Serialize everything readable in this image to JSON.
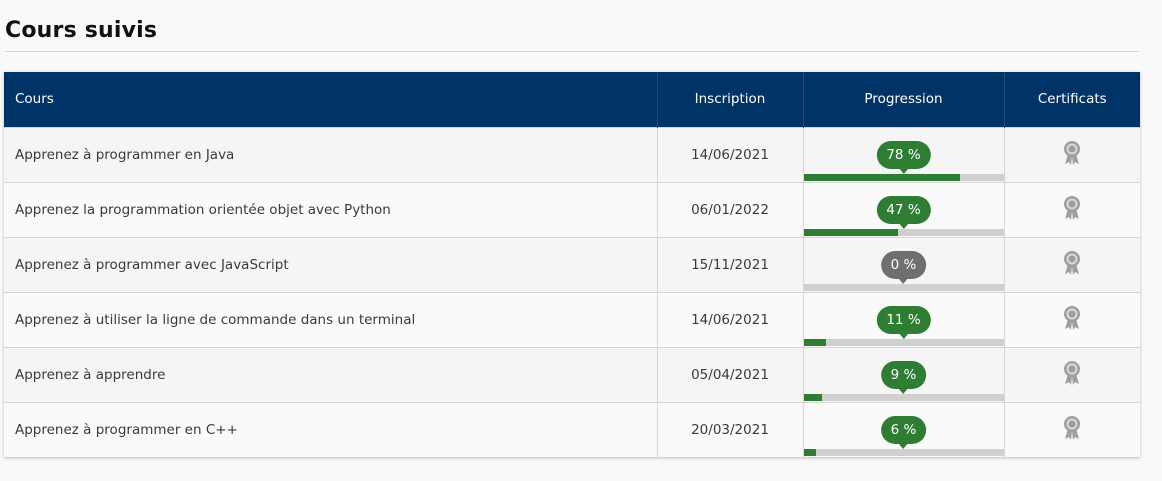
{
  "page": {
    "title": "Cours suivis"
  },
  "table": {
    "headers": {
      "course": "Cours",
      "enrollment": "Inscription",
      "progress": "Progression",
      "certificates": "Certificats"
    },
    "rows": [
      {
        "course": "Apprenez à programmer en Java",
        "date": "14/06/2021",
        "progress": 0.78,
        "progress_label": "78 %"
      },
      {
        "course": "Apprenez la programmation orientée objet avec Python",
        "date": "06/01/2022",
        "progress": 0.47,
        "progress_label": "47 %"
      },
      {
        "course": "Apprenez à programmer avec JavaScript",
        "date": "15/11/2021",
        "progress": 0.0,
        "progress_label": "0 %"
      },
      {
        "course": "Apprenez à utiliser la ligne de commande dans un terminal",
        "date": "14/06/2021",
        "progress": 0.11,
        "progress_label": "11 %"
      },
      {
        "course": "Apprenez à apprendre",
        "date": "05/04/2021",
        "progress": 0.09,
        "progress_label": "9 %"
      },
      {
        "course": "Apprenez à programmer en C++",
        "date": "20/03/2021",
        "progress": 0.06,
        "progress_label": "6 %"
      }
    ]
  },
  "icons": {
    "certificate": "award-ribbon-icon"
  },
  "colors": {
    "header_bg": "#003366",
    "progress_active": "#2e7d32",
    "progress_zero": "#6f6f6f",
    "track": "#d0d0d0",
    "certificate_icon": "#9e9e9e"
  }
}
